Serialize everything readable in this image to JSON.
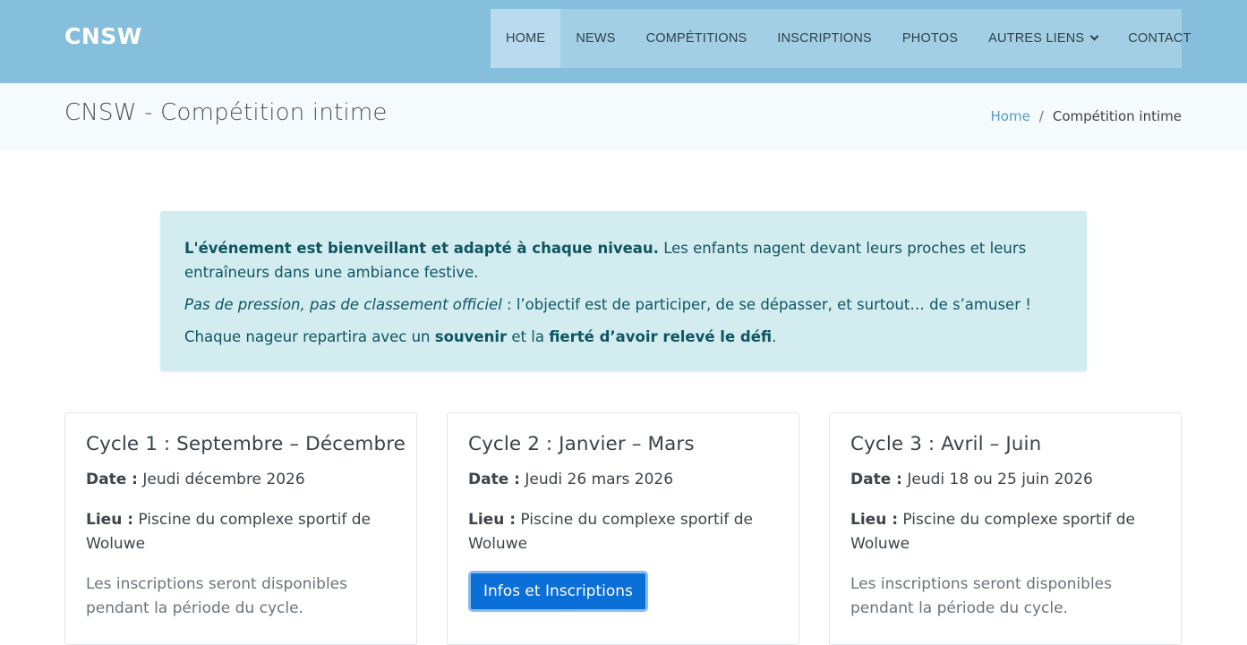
{
  "header": {
    "logo": "CNSW",
    "nav": [
      {
        "label": "HOME",
        "active": true
      },
      {
        "label": "NEWS"
      },
      {
        "label": "COMPÉTITIONS"
      },
      {
        "label": "INSCRIPTIONS"
      },
      {
        "label": "PHOTOS"
      },
      {
        "label": "AUTRES LIENS",
        "dropdown": true
      },
      {
        "label": "CONTACT"
      }
    ]
  },
  "titlebar": {
    "title": "CNSW - Compétition intime",
    "breadcrumb": {
      "home": "Home",
      "separator": "/",
      "current": "Compétition intime"
    }
  },
  "alert": {
    "p1_bold": "L'événement est bienveillant et adapté à chaque niveau.",
    "p1_rest": " Les enfants nagent devant leurs proches et leurs entraîneurs dans une ambiance festive.",
    "p2_italic": "Pas de pression, pas de classement officiel",
    "p2_rest": " : l’objectif est de participer, de se dépasser, et surtout… de s’amuser !",
    "p3_a": "Chaque nageur repartira avec un ",
    "p3_b1": "souvenir",
    "p3_c": " et la ",
    "p3_b2": "fierté d’avoir relevé le défi",
    "p3_d": "."
  },
  "cards": [
    {
      "title": "Cycle 1 : Septembre – Décembre",
      "date_label": "Date :",
      "date_value": " Jeudi décembre 2026",
      "lieu_label": "Lieu :",
      "lieu_value": " Piscine du complexe sportif de Woluwe",
      "note": "Les inscriptions seront disponibles pendant la période du cycle."
    },
    {
      "title": "Cycle 2 : Janvier – Mars",
      "date_label": "Date :",
      "date_value": " Jeudi 26 mars 2026",
      "lieu_label": "Lieu :",
      "lieu_value": " Piscine du complexe sportif de Woluwe",
      "button": "Infos et Inscriptions"
    },
    {
      "title": "Cycle 3 : Avril – Juin",
      "date_label": "Date :",
      "date_value": " Jeudi 18 ou 25 juin 2026",
      "lieu_label": "Lieu :",
      "lieu_value": " Piscine du complexe sportif de Woluwe",
      "note": "Les inscriptions seront disponibles pendant la période du cycle."
    }
  ],
  "colors": {
    "header_bg": "#86bfdb",
    "nav_bg": "#a3cfe5",
    "alert_bg": "#d2ecef",
    "alert_text": "#0f5561",
    "button_bg": "#0b6fd8"
  }
}
